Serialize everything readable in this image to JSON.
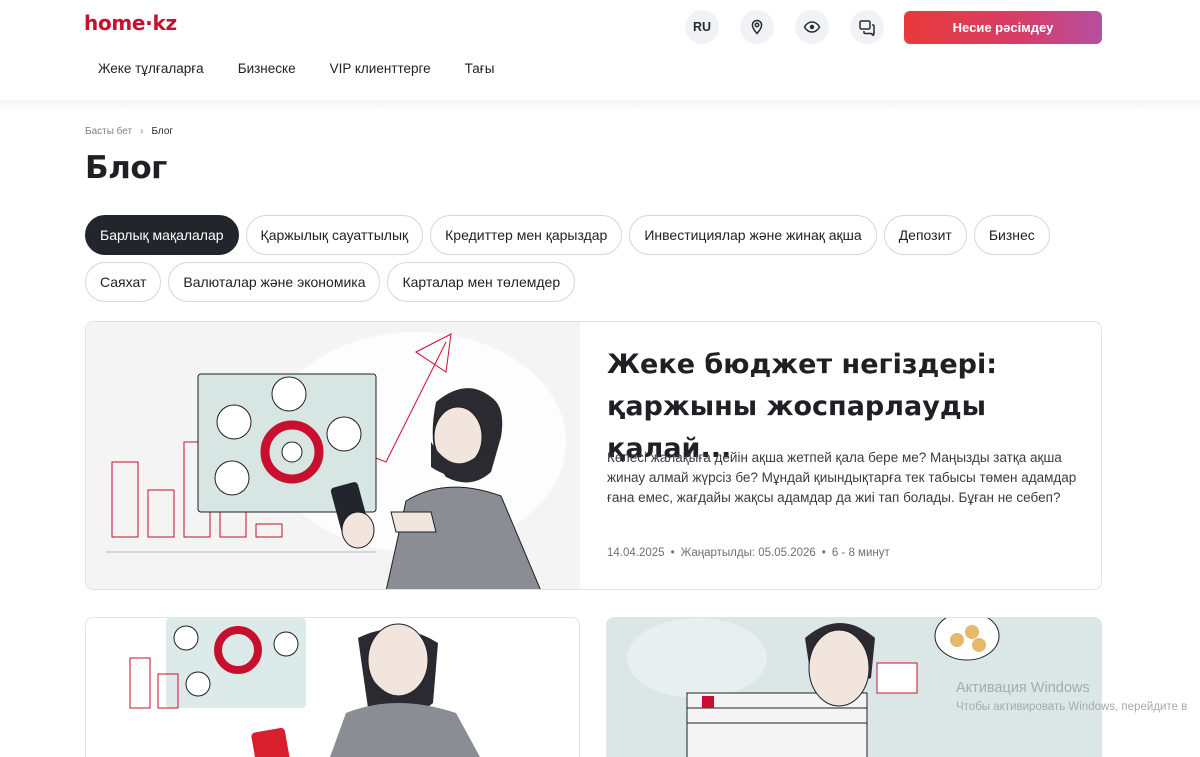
{
  "header": {
    "logo": "home·kz",
    "nav": [
      "Жеке тұлғаларға",
      "Бизнеске",
      "VIP клиенттерге",
      "Тағы"
    ],
    "lang": "RU",
    "cta": "Несие рәсімдеу",
    "icons": [
      "location-pin-icon",
      "eye-icon",
      "chat-icon"
    ]
  },
  "breadcrumb": {
    "home": "Басты бет",
    "sep": "›",
    "current": "Блог"
  },
  "page_title": "Блог",
  "chips": [
    {
      "label": "Барлық мақалалар",
      "active": true
    },
    {
      "label": "Қаржылық сауаттылық"
    },
    {
      "label": "Кредиттер мен қарыздар"
    },
    {
      "label": "Инвестициялар және жинақ ақша"
    },
    {
      "label": "Депозит"
    },
    {
      "label": "Бизнес"
    },
    {
      "label": "Саяхат"
    },
    {
      "label": "Валюталар және экономика"
    },
    {
      "label": "Карталар мен төлемдер"
    }
  ],
  "feature": {
    "title": "Жеке бюджет негіздері: қаржыны жоспарлауды қалай...",
    "description": "Келесі жалақыға дейін ақша жетпей қала бере ме? Маңызды затқа ақша жинау алмай жүрсіз бе? Мұндай қиындықтарға тек табысы төмен адамдар ғана емес, жағдайы жақсы адамдар да жиі тап болады. Бұған не себеп?",
    "date": "14.04.2025",
    "updated": "Жаңартылды: 05.05.2026",
    "read_time": "6 - 8 минут",
    "bullet": "•"
  },
  "watermark": {
    "line1": "Активация Windows",
    "line2": "Чтобы активировать Windows, перейдите в"
  },
  "colors": {
    "brand": "#c8102e",
    "chip_active": "#22252c",
    "cta_from": "#e93a3a",
    "cta_to": "#b64ea0"
  }
}
